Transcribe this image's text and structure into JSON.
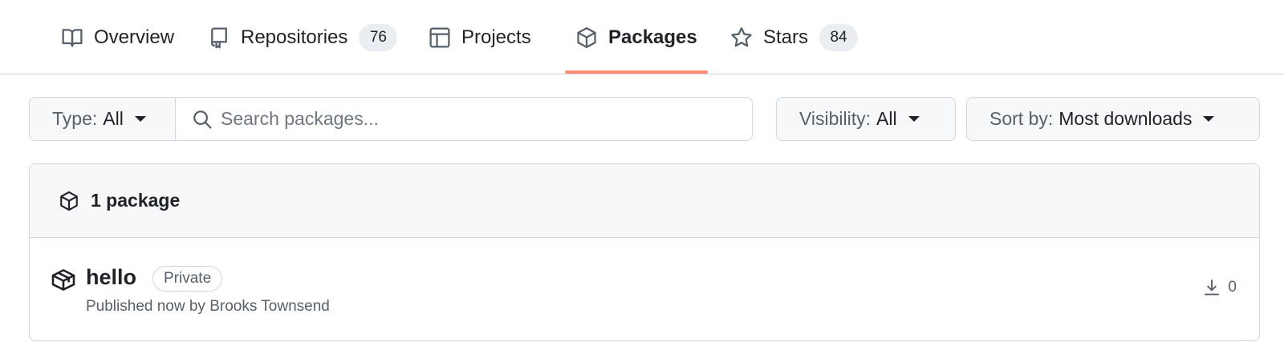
{
  "tabs": [
    {
      "label": "Overview",
      "icon": "book-icon"
    },
    {
      "label": "Repositories",
      "icon": "repo-icon",
      "count": "76"
    },
    {
      "label": "Projects",
      "icon": "table-icon"
    },
    {
      "label": "Packages",
      "icon": "package-icon",
      "active": true
    },
    {
      "label": "Stars",
      "icon": "star-icon",
      "count": "84"
    }
  ],
  "filters": {
    "type_label": "Type:",
    "type_value": "All",
    "search_placeholder": "Search packages...",
    "visibility_label": "Visibility:",
    "visibility_value": "All",
    "sort_label": "Sort by:",
    "sort_value": "Most downloads"
  },
  "packages": {
    "count_label": "1 package",
    "items": [
      {
        "name": "hello",
        "visibility": "Private",
        "meta": "Published now by Brooks Townsend",
        "downloads": "0"
      }
    ]
  },
  "colors": {
    "accent_underline": "#fd8c73",
    "border": "#d0d7de",
    "muted_text": "#57606a"
  }
}
